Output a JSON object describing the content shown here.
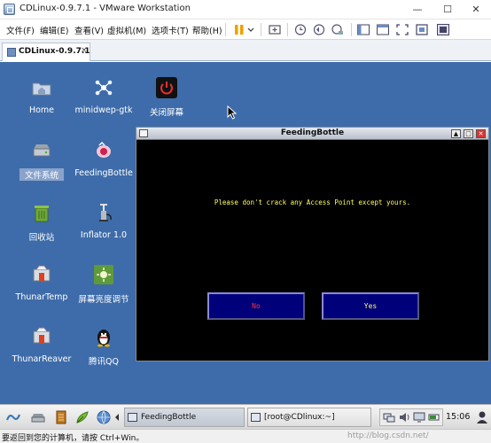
{
  "window": {
    "title": "CDLinux-0.9.7.1 - VMware Workstation",
    "minimize_glyph": "—",
    "maximize_glyph": "☐",
    "close_glyph": "✕"
  },
  "menu": {
    "file": "文件(F)",
    "edit": "编辑(E)",
    "view": "查看(V)",
    "vm": "虚拟机(M)",
    "tabs": "选项卡(T)",
    "help": "帮助(H)"
  },
  "vm_tab": {
    "label": "CDLinux-0.9.7.1",
    "close_glyph": "×"
  },
  "desktop_icons": [
    {
      "label": "Home",
      "icon": "home-folder-icon"
    },
    {
      "label": "minidwep-gtk",
      "icon": "minidwep-gtk-icon"
    },
    {
      "label": "关闭屏幕",
      "icon": "power-icon"
    },
    {
      "label": "文件系统",
      "icon": "drive-icon"
    },
    {
      "label": "FeedingBottle",
      "icon": "feeding-bottle-icon"
    },
    {
      "label": "回收站",
      "icon": "trash-icon"
    },
    {
      "label": "Inflator 1.0",
      "icon": "pump-icon"
    },
    {
      "label": "ThunarTemp",
      "icon": "thunar-icon"
    },
    {
      "label": "屏幕亮度调节",
      "icon": "brightness-icon"
    },
    {
      "label": "ThunarReaver",
      "icon": "thunar-icon"
    },
    {
      "label": "腾讯QQ",
      "icon": "qq-penguin-icon"
    }
  ],
  "dialog": {
    "title": "FeedingBottle",
    "message": "Please don't crack any Access Point except yours.",
    "no_label": "No",
    "yes_label": "Yes",
    "shade_glyph": "▲",
    "maximize_glyph": "□",
    "close_glyph": "✕"
  },
  "taskbar": {
    "tasks": [
      "FeedingBottle",
      "[root@CDlinux:~]"
    ],
    "clock": "15:06"
  },
  "statusbar": {
    "text": "要返回到您的计算机，请按 Ctrl+Win。",
    "watermark": "http://blog.csdn.net/"
  },
  "colors": {
    "desktop": "#3e6caa",
    "dialog_text": "#ffff66",
    "no_button_text": "#ff3333",
    "button_fill": "#00007a"
  }
}
